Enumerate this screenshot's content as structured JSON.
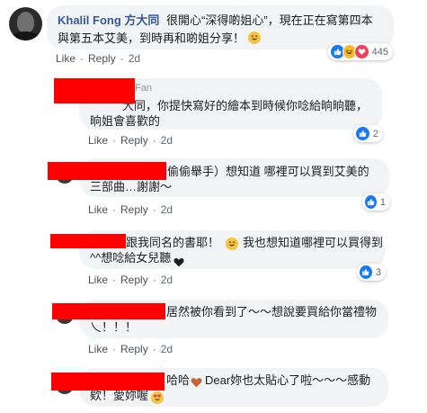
{
  "post": {
    "author": "Khalil Fong 方大同",
    "text_line1": "很開心“深得啲姐心”，現在正在寫第四本",
    "text_line2": "與第五本艾美，到時再和啲姐分享！",
    "emoji": "grinning-face",
    "like_label": "Like",
    "reply_label": "Reply",
    "time": "2d",
    "reaction_count": "445",
    "reactions": [
      "like-reaction",
      "haha-reaction",
      "love-reaction"
    ]
  },
  "replies": [
    {
      "author_tail": "Fan",
      "line1": "大同，你提快寫好的繪本到時候你唸給晌晌聽，",
      "line2": "晌姐會喜歡的",
      "like_label": "Like",
      "reply_label": "Reply",
      "time": "2d",
      "reaction_count": "2"
    },
    {
      "line1": "偷偷舉手）想知道 哪裡可以買到艾美的",
      "line2": "三部曲…謝謝～",
      "like_label": "Like",
      "reply_label": "Reply",
      "time": "2d",
      "reaction_count": "1"
    },
    {
      "line1": "跟我同名的書耶！",
      "line1b": "我也想知道哪裡可以買得到",
      "line2": "^^想唸給女兒聽",
      "like_label": "Like",
      "reply_label": "Reply",
      "time": "2d",
      "reaction_count": "3"
    },
    {
      "line1": "居然被你看到了～～想說要買給你當禮物",
      "line2": "乀！！！",
      "like_label": "Like",
      "reply_label": "Reply",
      "time": "2d"
    },
    {
      "line1a": "哈哈",
      "line1b": "Dear妳也太貼心了啦～～～感動",
      "line2": "欸！愛妳喔"
    }
  ],
  "colors": {
    "name": "#385898",
    "bubble": "#f2f3f5",
    "redaction": "#ff0000",
    "like": "#1877f2"
  }
}
